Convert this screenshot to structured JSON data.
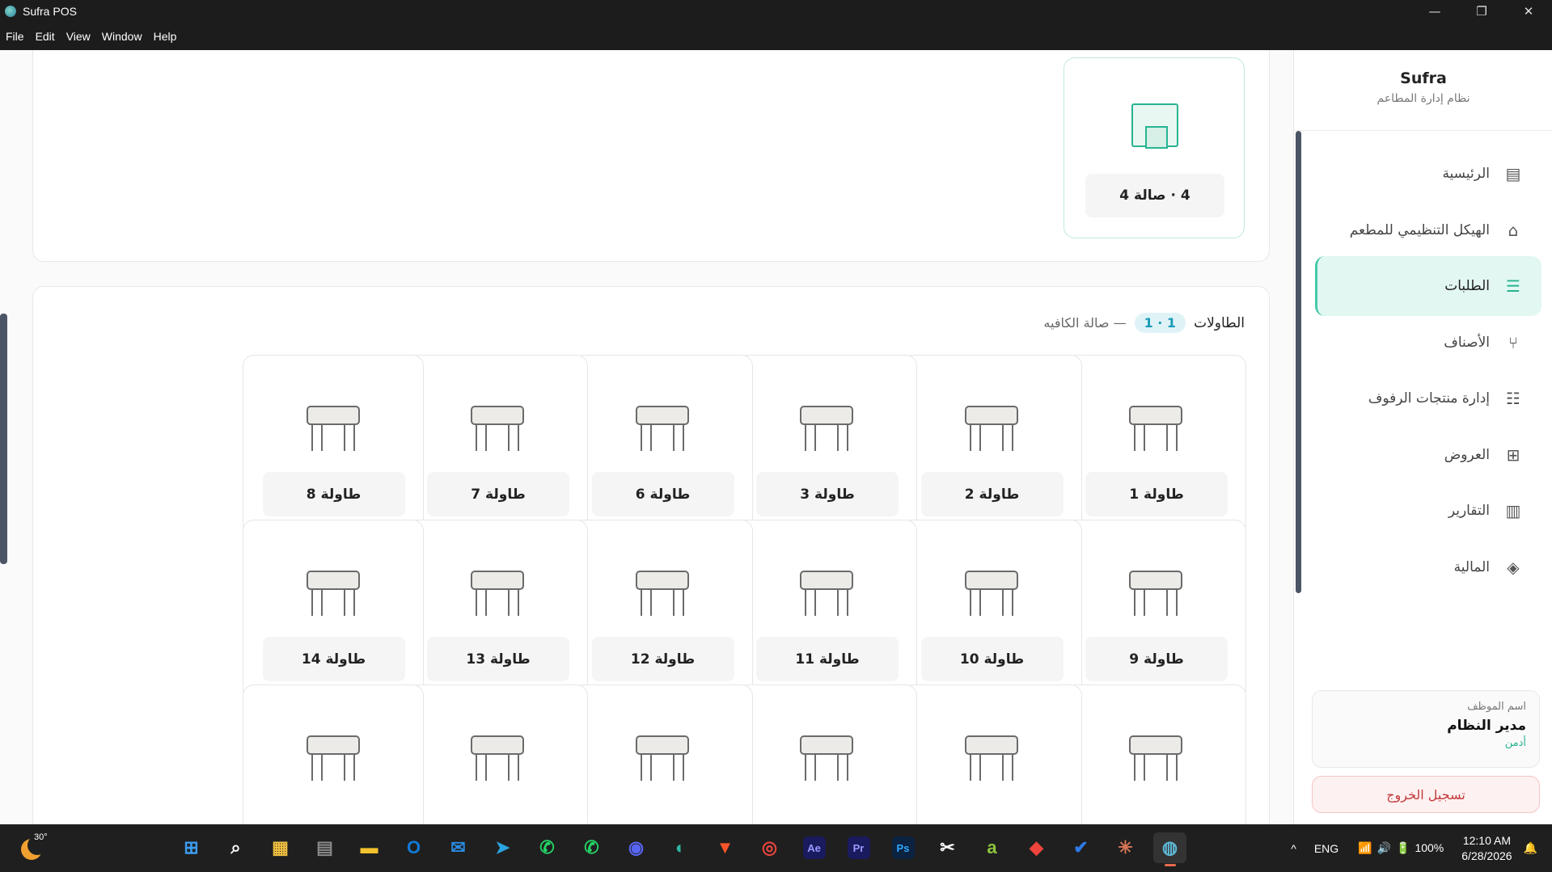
{
  "window": {
    "title": "Sufra POS",
    "controls": {
      "minimize": "—",
      "maximize": "❐",
      "close": "✕"
    }
  },
  "menu": [
    "File",
    "Edit",
    "View",
    "Window",
    "Help"
  ],
  "halls": {
    "card_label": "4 · صالة 4",
    "icon": "hall-room-icon"
  },
  "tables_section": {
    "title": "الطاولات",
    "badge": "1 · 1",
    "hall_name": "— صالة الكافيه",
    "rows": [
      [
        "طاولة 1",
        "طاولة 2",
        "طاولة 3",
        "طاولة 6",
        "طاولة 7",
        "طاولة 8"
      ],
      [
        "طاولة 9",
        "طاولة 10",
        "طاولة 11",
        "طاولة 12",
        "طاولة 13",
        "طاولة 14"
      ],
      [
        "",
        "",
        "",
        "",
        "",
        ""
      ]
    ]
  },
  "sidebar": {
    "brand": "Sufra",
    "subtitle": "نظام إدارة المطاعم",
    "items": [
      {
        "label": "الرئيسية",
        "icon": "receipt-icon",
        "glyph": "▤"
      },
      {
        "label": "الهيكل التنظيمي للمطعم",
        "icon": "sofa-icon",
        "glyph": "⌂"
      },
      {
        "label": "الطلبات",
        "icon": "clipboard-icon",
        "glyph": "☰",
        "active": true
      },
      {
        "label": "الأصناف",
        "icon": "utensils-icon",
        "glyph": "⑂"
      },
      {
        "label": "إدارة منتجات الرفوف",
        "icon": "shelves-icon",
        "glyph": "☷"
      },
      {
        "label": "العروض",
        "icon": "gift-icon",
        "glyph": "⊞"
      },
      {
        "label": "التقارير",
        "icon": "bar-chart-icon",
        "glyph": "▥"
      },
      {
        "label": "المالية",
        "icon": "layers-icon",
        "glyph": "◈"
      }
    ],
    "user": {
      "label": "اسم الموظف",
      "name": "مدير النظام",
      "role": "أدمن"
    },
    "logout": "تسجيل الخروج"
  },
  "taskbar": {
    "weather_temp": "30°",
    "apps": [
      {
        "name": "windows-start-icon",
        "glyph": "⊞",
        "color": "#3b9cf0"
      },
      {
        "name": "search-icon",
        "glyph": "⌕",
        "color": "#ffffff"
      },
      {
        "name": "store-icon",
        "glyph": "▦",
        "color": "#f0c040"
      },
      {
        "name": "calculator-icon",
        "glyph": "▤",
        "color": "#8a8a8a"
      },
      {
        "name": "file-explorer-icon",
        "glyph": "▬",
        "color": "#f2c12e"
      },
      {
        "name": "outlook-icon",
        "glyph": "O",
        "color": "#1479d6"
      },
      {
        "name": "mail-icon",
        "glyph": "✉",
        "color": "#2a8be0"
      },
      {
        "name": "telegram-icon",
        "glyph": "➤",
        "color": "#2aa3e0"
      },
      {
        "name": "whatsapp-icon",
        "glyph": "✆",
        "color": "#25d366"
      },
      {
        "name": "whatsapp-business-icon",
        "glyph": "✆",
        "color": "#25d366"
      },
      {
        "name": "discord-icon",
        "glyph": "◉",
        "color": "#5865f2"
      },
      {
        "name": "edge-icon",
        "glyph": "◐",
        "color": "#2fb6a2"
      },
      {
        "name": "brave-icon",
        "glyph": "▼",
        "color": "#fb542b"
      },
      {
        "name": "chrome-icon",
        "glyph": "◎",
        "color": "#e8453c"
      },
      {
        "name": "after-effects-icon",
        "glyph": "Ae",
        "color": "#1a1a5e"
      },
      {
        "name": "premiere-icon",
        "glyph": "Pr",
        "color": "#1a1a5e"
      },
      {
        "name": "photoshop-icon",
        "glyph": "Ps",
        "color": "#0b2240"
      },
      {
        "name": "capcut-icon",
        "glyph": "✂",
        "color": "#ffffff"
      },
      {
        "name": "app-green-icon",
        "glyph": "a",
        "color": "#8cc63f"
      },
      {
        "name": "anydesk-icon",
        "glyph": "◆",
        "color": "#ef443b"
      },
      {
        "name": "todo-icon",
        "glyph": "✔",
        "color": "#2f7ae5"
      },
      {
        "name": "claude-icon",
        "glyph": "✳",
        "color": "#d97757"
      },
      {
        "name": "sufra-pos-icon",
        "glyph": "◍",
        "color": "#5fb8d6",
        "active": true
      }
    ],
    "tray": {
      "chevron": "^",
      "lang": "ENG",
      "battery": "100%",
      "time": "12:10 AM",
      "date": "6/28/2026"
    }
  }
}
